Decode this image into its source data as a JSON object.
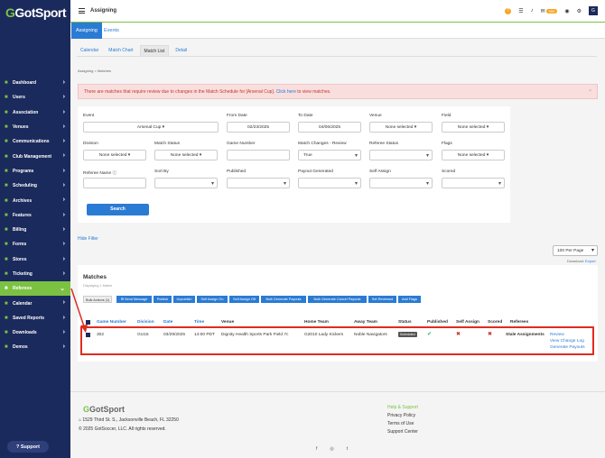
{
  "brand": {
    "logo_text": "GotSport"
  },
  "sidebar": {
    "items": [
      {
        "label": "Dashboard",
        "icon": "dashboard-icon"
      },
      {
        "label": "Users",
        "icon": "users-icon"
      },
      {
        "label": "Association",
        "icon": "association-icon"
      },
      {
        "label": "Venues",
        "icon": "venues-icon"
      },
      {
        "label": "Communications",
        "icon": "communications-icon"
      },
      {
        "label": "Club Management",
        "icon": "club-icon"
      },
      {
        "label": "Programs",
        "icon": "programs-icon"
      },
      {
        "label": "Scheduling",
        "icon": "scheduling-icon"
      },
      {
        "label": "Archives",
        "icon": "archives-icon"
      },
      {
        "label": "Features",
        "icon": "features-icon"
      },
      {
        "label": "Billing",
        "icon": "billing-icon"
      },
      {
        "label": "Forms",
        "icon": "forms-icon"
      },
      {
        "label": "Stores",
        "icon": "stores-icon"
      },
      {
        "label": "Ticketing",
        "icon": "ticketing-icon"
      },
      {
        "label": "Referees",
        "icon": "referees-icon"
      },
      {
        "label": "Calendar",
        "icon": "calendar-icon"
      },
      {
        "label": "Saved Reports",
        "icon": "reports-icon"
      },
      {
        "label": "Downloads",
        "icon": "downloads-icon"
      },
      {
        "label": "Demos",
        "icon": "demos-icon"
      }
    ],
    "active": "Referees",
    "support_label": "Support"
  },
  "topbar": {
    "title": "Assigning",
    "badge": "999",
    "avatar": "G"
  },
  "tabs": {
    "primary": [
      "Assigning",
      "Events"
    ],
    "secondary": [
      "Calendar",
      "Match Chart",
      "Match List",
      "Detail"
    ]
  },
  "breadcrumb": {
    "root": "Assigning",
    "sep": ">",
    "current": "Matches"
  },
  "alert": {
    "text": "There are matches that require review due to changes in the Match Schedule for [Arsenal Cup].",
    "link": "Click here",
    "tail": "to view matches.",
    "close": "×"
  },
  "filters": {
    "event": {
      "label": "Event",
      "value": "Arsenal Cup"
    },
    "from_date": {
      "label": "From Date",
      "value": "02/23/2025"
    },
    "to_date": {
      "label": "To Date",
      "value": "04/06/2025"
    },
    "venue": {
      "label": "Venue",
      "value": "None selected"
    },
    "field": {
      "label": "Field",
      "value": "None selected"
    },
    "division": {
      "label": "Division",
      "value": "None selected"
    },
    "match_status": {
      "label": "Match Status",
      "value": "None selected"
    },
    "game_number": {
      "label": "Game Number",
      "value": ""
    },
    "match_changes": {
      "label": "Match Changes - Review",
      "value": "True"
    },
    "referee_status": {
      "label": "Referee Status",
      "value": ""
    },
    "flags": {
      "label": "Flags",
      "value": "None selected"
    },
    "referee_name": {
      "label": "Referee Name",
      "value": ""
    },
    "sort_by": {
      "label": "Sort By",
      "value": ""
    },
    "published": {
      "label": "Published",
      "value": ""
    },
    "payout_generated": {
      "label": "Payout Generated",
      "value": ""
    },
    "self_assign": {
      "label": "Self Assign",
      "value": ""
    },
    "scored": {
      "label": "Scored",
      "value": ""
    },
    "search_label": "Search"
  },
  "hide_filter": "Hide Filter",
  "per_page": "100 Per Page",
  "download": {
    "label": "Download:",
    "link": "Export"
  },
  "matches": {
    "title": "Matches",
    "subtitle": "Displaying 1 Match",
    "bulk_actions": "Bulk Actions (1)",
    "actions": [
      "Send Message",
      "Publish",
      "Unpublish",
      "Self Assign On",
      "Self Assign Off",
      "Bulk Generate Payouts",
      "Bulk Generate Cancel Payouts",
      "Set Reviewed",
      "Add Flags"
    ],
    "headers": [
      "Game Number",
      "Division",
      "Date",
      "Time",
      "Venue",
      "Home Team",
      "Away Team",
      "Status",
      "Published",
      "Self Assign",
      "Scored",
      "Referees"
    ],
    "row": {
      "game_number": "302",
      "division": "GU15",
      "date": "03/29/2025",
      "time": "14:00 PDT",
      "venue": "Dignity Health Sports Park Field 7c",
      "home_team": "G2010 Lady Kickers",
      "away_team": "Noble Navigators",
      "status": "Scheduled",
      "published": "✔",
      "self_assign": "✖",
      "scored": "✖",
      "referees": "Stale Assignments",
      "links": [
        "Review",
        "View Change Log",
        "Generate Payouts"
      ]
    }
  },
  "footer": {
    "logo": "GotSport",
    "address": "1529 Third St. S., Jacksonville Beach, FL 32250",
    "copyright": "© 2025 GotSoccer, LLC. All rights reserved.",
    "links": [
      "Help & Support",
      "Privacy Policy",
      "Terms of Use",
      "Support Center"
    ],
    "socials": [
      "f",
      "◎",
      "t"
    ]
  },
  "colors": {
    "navy": "#1b2a5c",
    "green": "#7cc242",
    "blue": "#2a7bd4",
    "highlight": "#e02b20"
  }
}
